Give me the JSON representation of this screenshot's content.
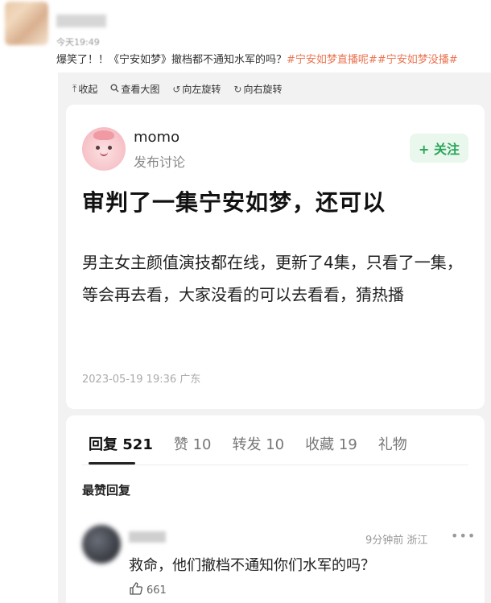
{
  "post": {
    "time": "今天19:49",
    "text_plain": "爆笑了！！《宁安如梦》撤档都不通知水军的吗？",
    "hashtags": [
      "#宁安如梦直播呢#",
      "#宁安如梦没播#"
    ]
  },
  "toolbar": {
    "collapse": "收起",
    "view_large": "查看大图",
    "rotate_left": "向左旋转",
    "rotate_right": "向右旋转"
  },
  "card": {
    "username": "momo",
    "subtitle": "发布讨论",
    "follow_label": "+ 关注",
    "title": "审判了一集宁安如梦，还可以",
    "body": "男主女主颜值演技都在线，更新了4集，只看了一集，等会再去看，大家没看的可以去看看，猜热播",
    "date": "2023-05-19 19:36 广东"
  },
  "tabs": [
    {
      "label": "回复",
      "count": "521"
    },
    {
      "label": "赞",
      "count": "10"
    },
    {
      "label": "转发",
      "count": "10"
    },
    {
      "label": "收藏",
      "count": "19"
    },
    {
      "label": "礼物",
      "count": ""
    }
  ],
  "comments": {
    "section_title": "最赞回复",
    "items": [
      {
        "meta": "9分钟前 浙江",
        "more": "•••",
        "text": "救命，他们撤档不通知你们水军的吗？",
        "likes": "661"
      }
    ]
  },
  "colors": {
    "hashtag": "#eb7350",
    "follow_text": "#2aa55a",
    "follow_bg": "#e9f7ec"
  }
}
